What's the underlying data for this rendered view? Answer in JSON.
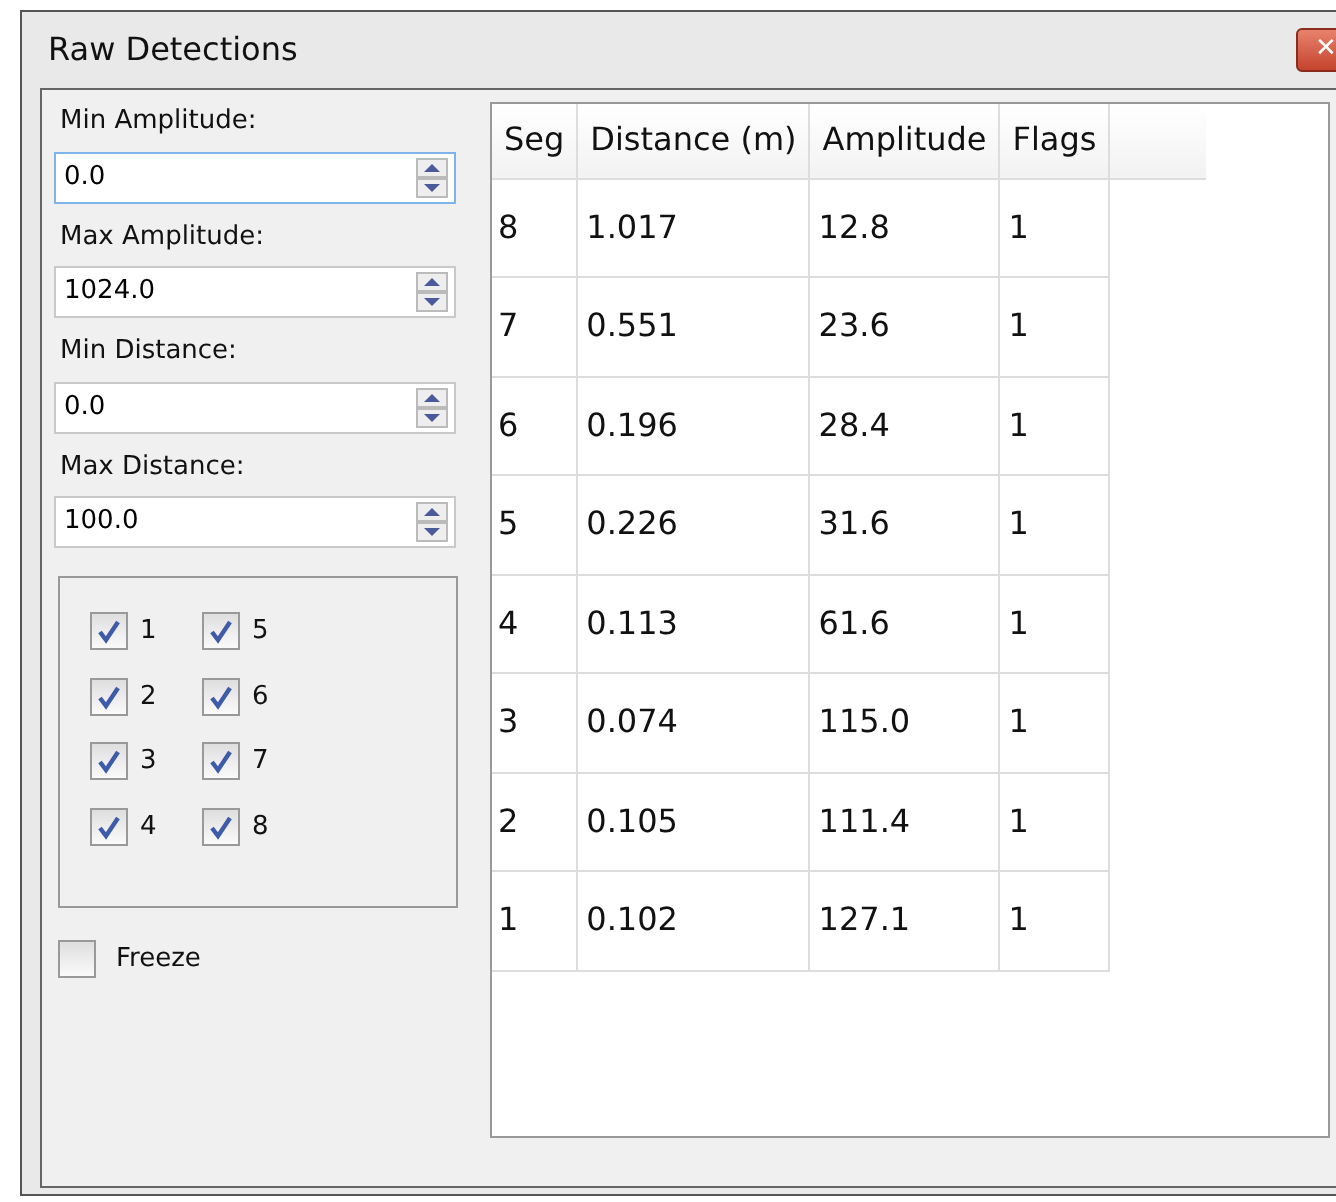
{
  "window": {
    "title": "Raw Detections",
    "close": "✕"
  },
  "fields": [
    {
      "label": "Min Amplitude:",
      "value": "0.0",
      "focused": true
    },
    {
      "label": "Max Amplitude:",
      "value": "1024.0",
      "focused": false
    },
    {
      "label": "Min Distance:",
      "value": "0.0",
      "focused": false
    },
    {
      "label": "Max Distance:",
      "value": "100.0",
      "focused": false
    }
  ],
  "segments": [
    {
      "label": "1",
      "checked": true
    },
    {
      "label": "2",
      "checked": true
    },
    {
      "label": "3",
      "checked": true
    },
    {
      "label": "4",
      "checked": true
    },
    {
      "label": "5",
      "checked": true
    },
    {
      "label": "6",
      "checked": true
    },
    {
      "label": "7",
      "checked": true
    },
    {
      "label": "8",
      "checked": true
    }
  ],
  "freeze": {
    "label": "Freeze",
    "checked": false
  },
  "table": {
    "columns": [
      "Seg",
      "Distance (m)",
      "Amplitude",
      "Flags"
    ],
    "rows": [
      [
        "8",
        "1.017",
        "12.8",
        "1"
      ],
      [
        "7",
        "0.551",
        "23.6",
        "1"
      ],
      [
        "6",
        "0.196",
        "28.4",
        "1"
      ],
      [
        "5",
        "0.226",
        "31.6",
        "1"
      ],
      [
        "4",
        "0.113",
        "61.6",
        "1"
      ],
      [
        "3",
        "0.074",
        "115.0",
        "1"
      ],
      [
        "2",
        "0.105",
        "111.4",
        "1"
      ],
      [
        "1",
        "0.102",
        "127.1",
        "1"
      ]
    ]
  }
}
